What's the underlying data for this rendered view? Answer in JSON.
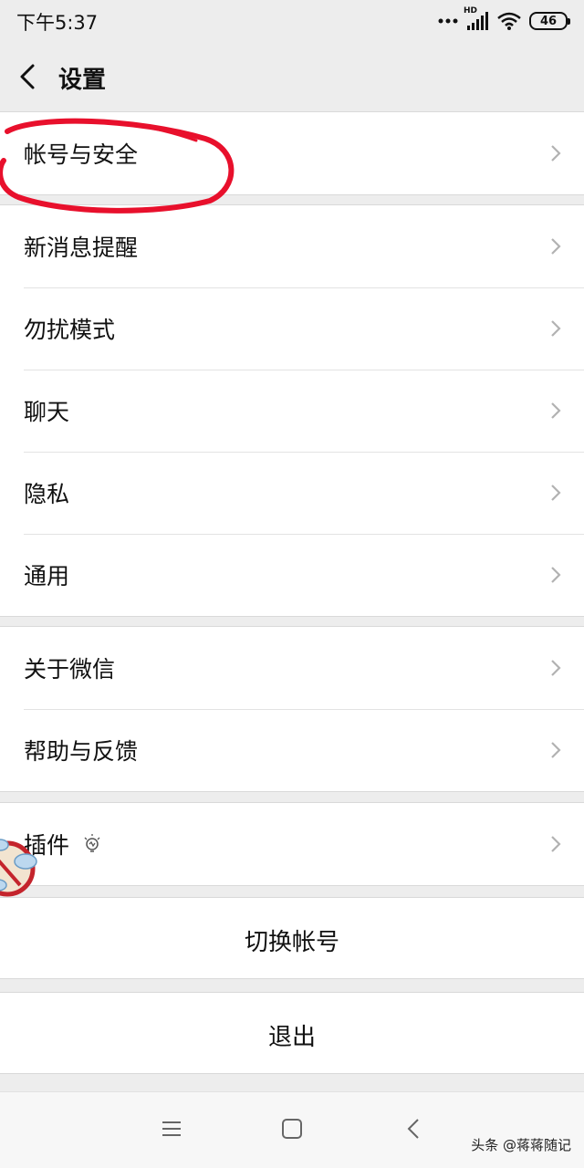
{
  "status_bar": {
    "time": "下午5:37",
    "network_label": "HD",
    "battery": "46"
  },
  "header": {
    "title": "设置"
  },
  "groups": [
    {
      "items": [
        {
          "label": "帐号与安全"
        }
      ]
    },
    {
      "items": [
        {
          "label": "新消息提醒"
        },
        {
          "label": "勿扰模式"
        },
        {
          "label": "聊天"
        },
        {
          "label": "隐私"
        },
        {
          "label": "通用"
        }
      ]
    },
    {
      "items": [
        {
          "label": "关于微信"
        },
        {
          "label": "帮助与反馈"
        }
      ]
    },
    {
      "items": [
        {
          "label": "插件"
        }
      ]
    }
  ],
  "actions": {
    "switch_account": "切换帐号",
    "logout": "退出"
  },
  "watermark": "头条 @蒋蒋随记",
  "colors": {
    "background": "#ededed",
    "annotation": "#e8102c"
  },
  "icons": {
    "back": "back-icon",
    "chevron": "chevron-right-icon",
    "plugin": "lightbulb-icon",
    "nav_menu": "menu-icon",
    "nav_home": "home-icon",
    "nav_back": "back-icon"
  }
}
